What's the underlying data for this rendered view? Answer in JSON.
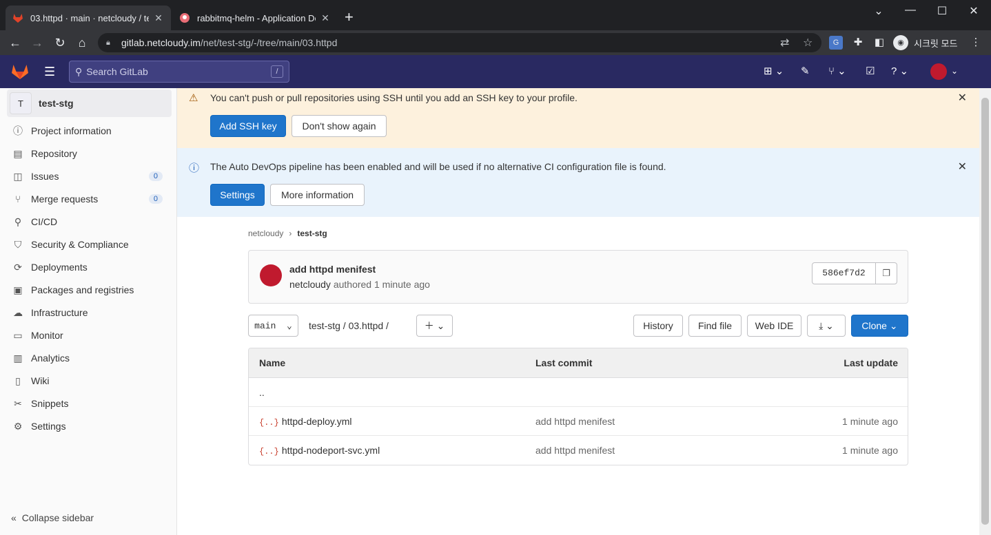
{
  "browser": {
    "tabs": [
      {
        "title": "03.httpd · main · netcloudy / te"
      },
      {
        "title": "rabbitmq-helm - Application De"
      }
    ],
    "url_host": "gitlab.netcloudy.im",
    "url_path": "/net/test-stg/-/tree/main/03.httpd",
    "incognito_label": "시크릿 모드"
  },
  "topnav": {
    "search_placeholder": "Search GitLab",
    "search_shortcut": "/"
  },
  "sidebar": {
    "project_initial": "T",
    "project_name": "test-stg",
    "items": [
      {
        "label": "Project information",
        "icon": "info-icon"
      },
      {
        "label": "Repository",
        "icon": "doc-icon"
      },
      {
        "label": "Issues",
        "icon": "issues-icon",
        "badge": "0"
      },
      {
        "label": "Merge requests",
        "icon": "merge-request-icon",
        "badge": "0"
      },
      {
        "label": "CI/CD",
        "icon": "rocket-icon"
      },
      {
        "label": "Security & Compliance",
        "icon": "shield-icon"
      },
      {
        "label": "Deployments",
        "icon": "deployments-icon"
      },
      {
        "label": "Packages and registries",
        "icon": "package-icon"
      },
      {
        "label": "Infrastructure",
        "icon": "cloud-icon"
      },
      {
        "label": "Monitor",
        "icon": "monitor-icon"
      },
      {
        "label": "Analytics",
        "icon": "chart-icon"
      },
      {
        "label": "Wiki",
        "icon": "book-icon"
      },
      {
        "label": "Snippets",
        "icon": "scissors-icon"
      },
      {
        "label": "Settings",
        "icon": "gear-icon"
      }
    ],
    "collapse_label": "Collapse sidebar"
  },
  "alerts": {
    "ssh": {
      "text": "You can't push or pull repositories using SSH until you add an SSH key to your profile.",
      "primary": "Add SSH key",
      "secondary": "Don't show again"
    },
    "autodevops": {
      "text": "The Auto DevOps pipeline has been enabled and will be used if no alternative CI configuration file is found.",
      "primary": "Settings",
      "secondary": "More information"
    }
  },
  "breadcrumb": {
    "parent": "netcloudy",
    "separator": "›",
    "current": "test-stg"
  },
  "commit": {
    "title": "add httpd menifest",
    "author": "netcloudy",
    "authored": "authored 1 minute ago",
    "sha": "586ef7d2"
  },
  "toolbar": {
    "branch": "main",
    "path": "test-stg  /  03.httpd  /",
    "history": "History",
    "find_file": "Find file",
    "web_ide": "Web IDE",
    "clone": "Clone"
  },
  "table": {
    "headers": {
      "name": "Name",
      "last_commit": "Last commit",
      "last_update": "Last update"
    },
    "parent_link": "..",
    "rows": [
      {
        "icon": "{..}",
        "name": "httpd-deploy.yml",
        "commit": "add httpd menifest",
        "updated": "1 minute ago"
      },
      {
        "icon": "{..}",
        "name": "httpd-nodeport-svc.yml",
        "commit": "add httpd menifest",
        "updated": "1 minute ago"
      }
    ]
  },
  "colors": {
    "gitlab_nav": "#292961",
    "primary_button": "#1f75cb",
    "warning_bg": "#fdf1dd",
    "info_bg": "#e9f3fc"
  }
}
